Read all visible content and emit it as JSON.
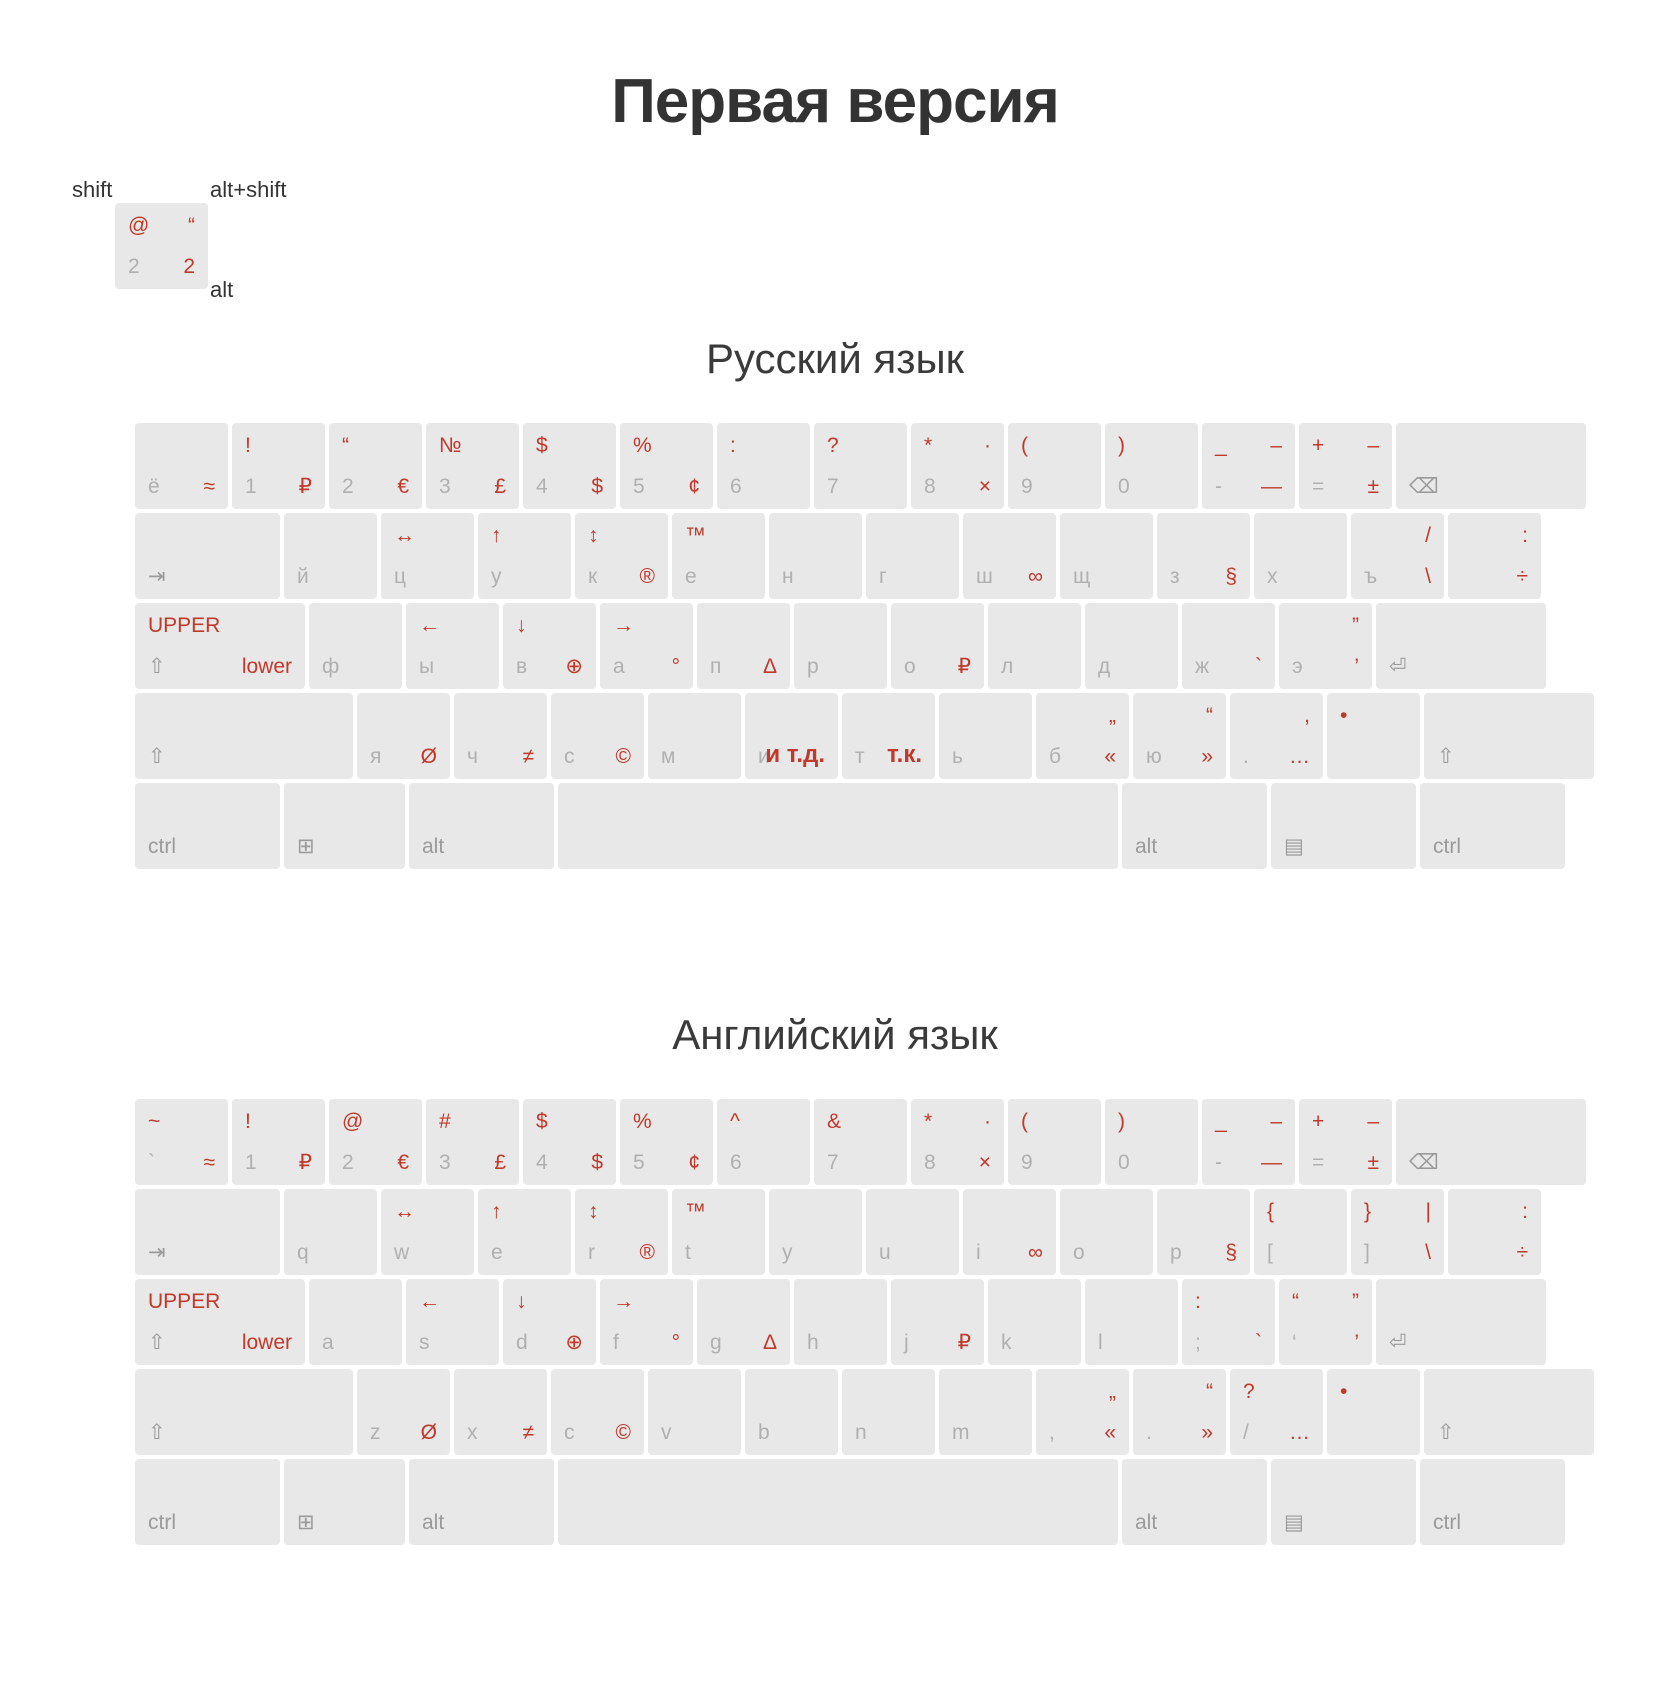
{
  "title": "Первая версия",
  "legend": {
    "shift_label": "shift",
    "altshift_label": "alt+shift",
    "alt_label": "alt",
    "key": {
      "tl": "@",
      "tr": "“",
      "bl": "2",
      "br": "2"
    }
  },
  "sections": [
    {
      "heading": "Русский язык",
      "rows": [
        {
          "name": "number-row",
          "keys": [
            {
              "tl": "",
              "tr": "",
              "bl": "ё",
              "br": "≈"
            },
            {
              "tl": "!",
              "tr": "",
              "bl": "1",
              "br": "₽"
            },
            {
              "tl": "“",
              "tr": "",
              "bl": "2",
              "br": "€"
            },
            {
              "tl": "№",
              "tr": "",
              "bl": "3",
              "br": "£"
            },
            {
              "tl": "$",
              "tr": "",
              "bl": "4",
              "br": "$"
            },
            {
              "tl": "%",
              "tr": "",
              "bl": "5",
              "br": "¢"
            },
            {
              "tl": ":",
              "tr": "",
              "bl": "6",
              "br": ""
            },
            {
              "tl": "?",
              "tr": "",
              "bl": "7",
              "br": ""
            },
            {
              "tl": "*",
              "tr": "·",
              "bl": "8",
              "br": "×"
            },
            {
              "tl": "(",
              "tr": "",
              "bl": "9",
              "br": ""
            },
            {
              "tl": ")",
              "tr": "",
              "bl": "0",
              "br": ""
            },
            {
              "tl": "_",
              "tr": "–",
              "bl": "-",
              "br": "—"
            },
            {
              "tl": "+",
              "tr": "–",
              "bl": "=",
              "br": "±"
            },
            {
              "tl": "",
              "tr": "",
              "bl": "⌫",
              "br": "",
              "width": "wbsp",
              "mod": true
            }
          ]
        },
        {
          "name": "tab-row",
          "keys": [
            {
              "tl": "",
              "tr": "",
              "bl": "⇥",
              "br": "",
              "width": "w150",
              "mod": true
            },
            {
              "tl": "",
              "tr": "",
              "bl": "й",
              "br": ""
            },
            {
              "tl": "↔",
              "tr": "",
              "bl": "ц",
              "br": ""
            },
            {
              "tl": "↑",
              "tr": "",
              "bl": "у",
              "br": ""
            },
            {
              "tl": "↕",
              "tr": "",
              "bl": "к",
              "br": "®"
            },
            {
              "tl": "™",
              "tr": "",
              "bl": "е",
              "br": ""
            },
            {
              "tl": "",
              "tr": "",
              "bl": "н",
              "br": ""
            },
            {
              "tl": "",
              "tr": "",
              "bl": "г",
              "br": ""
            },
            {
              "tl": "",
              "tr": "",
              "bl": "ш",
              "br": "∞"
            },
            {
              "tl": "",
              "tr": "",
              "bl": "щ",
              "br": ""
            },
            {
              "tl": "",
              "tr": "",
              "bl": "з",
              "br": "§"
            },
            {
              "tl": "",
              "tr": "",
              "bl": "х",
              "br": ""
            },
            {
              "tl": "",
              "tr": "/",
              "bl": "ъ",
              "br": "\\"
            },
            {
              "tl": "",
              "tr": ":",
              "bl": "",
              "br": "÷",
              "width": "w100"
            }
          ]
        },
        {
          "name": "caps-row",
          "keys": [
            {
              "tl": "UPPER",
              "tr": "",
              "bl": "⇧",
              "br": "lower",
              "width": "w175",
              "mod": true,
              "brRed": true
            },
            {
              "tl": "",
              "tr": "",
              "bl": "ф",
              "br": ""
            },
            {
              "tl": "←",
              "tr": "",
              "bl": "ы",
              "br": ""
            },
            {
              "tl": "↓",
              "tr": "",
              "bl": "в",
              "br": "⊕"
            },
            {
              "tl": "→",
              "tr": "",
              "bl": "а",
              "br": "°"
            },
            {
              "tl": "",
              "tr": "",
              "bl": "п",
              "br": "Δ"
            },
            {
              "tl": "",
              "tr": "",
              "bl": "р",
              "br": ""
            },
            {
              "tl": "",
              "tr": "",
              "bl": "о",
              "br": "₽"
            },
            {
              "tl": "",
              "tr": "",
              "bl": "л",
              "br": ""
            },
            {
              "tl": "",
              "tr": "",
              "bl": "д",
              "br": ""
            },
            {
              "tl": "",
              "tr": "",
              "bl": "ж",
              "br": "`"
            },
            {
              "tl": "",
              "tr": "”",
              "bl": "э",
              "br": "’"
            },
            {
              "tl": "",
              "tr": "",
              "bl": "⏎",
              "br": "",
              "width": "wenter",
              "mod": true
            }
          ]
        },
        {
          "name": "shift-row",
          "keys": [
            {
              "tl": "",
              "tr": "",
              "bl": "⇧",
              "br": "",
              "width": "w225",
              "mod": true
            },
            {
              "tl": "",
              "tr": "",
              "bl": "я",
              "br": "Ø"
            },
            {
              "tl": "",
              "tr": "",
              "bl": "ч",
              "br": "≠"
            },
            {
              "tl": "",
              "tr": "",
              "bl": "с",
              "br": "©"
            },
            {
              "tl": "",
              "tr": "",
              "bl": "м",
              "br": ""
            },
            {
              "tl": "",
              "tr": "",
              "bl": "и",
              "br": "и т.д.",
              "brWide": true
            },
            {
              "tl": "",
              "tr": "",
              "bl": "т",
              "br": "т.к.",
              "brWide": true
            },
            {
              "tl": "",
              "tr": "",
              "bl": "ь",
              "br": ""
            },
            {
              "tl": "",
              "tr": "„",
              "bl": "б",
              "br": "«"
            },
            {
              "tl": "",
              "tr": "“",
              "bl": "ю",
              "br": "»"
            },
            {
              "tl": "",
              "tr": ",",
              "bl": ".",
              "br": "…"
            },
            {
              "tl": "•",
              "tr": "",
              "bl": "",
              "br": "",
              "width": "w100"
            },
            {
              "tl": "",
              "tr": "",
              "bl": "⇧",
              "br": "",
              "width": "wshiftR",
              "mod": true
            }
          ]
        },
        {
          "name": "bottom-row",
          "keys": [
            {
              "tl": "",
              "tr": "",
              "bl": "ctrl",
              "br": "",
              "width": "w150",
              "mod": true
            },
            {
              "tl": "",
              "tr": "",
              "bl": "⊞",
              "br": "",
              "width": "w125",
              "mod": true
            },
            {
              "tl": "",
              "tr": "",
              "bl": "alt",
              "br": "",
              "width": "w150",
              "mod": true
            },
            {
              "tl": "",
              "tr": "",
              "bl": "",
              "br": "",
              "width": "wspace",
              "mod": true
            },
            {
              "tl": "",
              "tr": "",
              "bl": "alt",
              "br": "",
              "width": "w150",
              "mod": true
            },
            {
              "tl": "",
              "tr": "",
              "bl": "▤",
              "br": "",
              "width": "w150",
              "mod": true
            },
            {
              "tl": "",
              "tr": "",
              "bl": "ctrl",
              "br": "",
              "width": "w150",
              "mod": true
            }
          ]
        }
      ]
    },
    {
      "heading": "Английский язык",
      "rows": [
        {
          "name": "number-row",
          "keys": [
            {
              "tl": "~",
              "tr": "",
              "bl": "`",
              "br": "≈"
            },
            {
              "tl": "!",
              "tr": "",
              "bl": "1",
              "br": "₽"
            },
            {
              "tl": "@",
              "tr": "",
              "bl": "2",
              "br": "€"
            },
            {
              "tl": "#",
              "tr": "",
              "bl": "3",
              "br": "£"
            },
            {
              "tl": "$",
              "tr": "",
              "bl": "4",
              "br": "$"
            },
            {
              "tl": "%",
              "tr": "",
              "bl": "5",
              "br": "¢"
            },
            {
              "tl": "^",
              "tr": "",
              "bl": "6",
              "br": ""
            },
            {
              "tl": "&",
              "tr": "",
              "bl": "7",
              "br": ""
            },
            {
              "tl": "*",
              "tr": "·",
              "bl": "8",
              "br": "×"
            },
            {
              "tl": "(",
              "tr": "",
              "bl": "9",
              "br": ""
            },
            {
              "tl": ")",
              "tr": "",
              "bl": "0",
              "br": ""
            },
            {
              "tl": "_",
              "tr": "–",
              "bl": "-",
              "br": "—"
            },
            {
              "tl": "+",
              "tr": "–",
              "bl": "=",
              "br": "±"
            },
            {
              "tl": "",
              "tr": "",
              "bl": "⌫",
              "br": "",
              "width": "wbsp",
              "mod": true
            }
          ]
        },
        {
          "name": "tab-row",
          "keys": [
            {
              "tl": "",
              "tr": "",
              "bl": "⇥",
              "br": "",
              "width": "w150",
              "mod": true
            },
            {
              "tl": "",
              "tr": "",
              "bl": "q",
              "br": ""
            },
            {
              "tl": "↔",
              "tr": "",
              "bl": "w",
              "br": ""
            },
            {
              "tl": "↑",
              "tr": "",
              "bl": "e",
              "br": ""
            },
            {
              "tl": "↕",
              "tr": "",
              "bl": "r",
              "br": "®"
            },
            {
              "tl": "™",
              "tr": "",
              "bl": "t",
              "br": ""
            },
            {
              "tl": "",
              "tr": "",
              "bl": "y",
              "br": ""
            },
            {
              "tl": "",
              "tr": "",
              "bl": "u",
              "br": ""
            },
            {
              "tl": "",
              "tr": "",
              "bl": "i",
              "br": "∞"
            },
            {
              "tl": "",
              "tr": "",
              "bl": "o",
              "br": ""
            },
            {
              "tl": "",
              "tr": "",
              "bl": "p",
              "br": "§"
            },
            {
              "tl": "{",
              "tr": "",
              "bl": "[",
              "br": ""
            },
            {
              "tl": "}",
              "tr": "|",
              "bl": "]",
              "br": "\\"
            },
            {
              "tl": "",
              "tr": ":",
              "bl": "",
              "br": "÷",
              "width": "w100"
            }
          ]
        },
        {
          "name": "caps-row",
          "keys": [
            {
              "tl": "UPPER",
              "tr": "",
              "bl": "⇧",
              "br": "lower",
              "width": "w175",
              "mod": true,
              "brRed": true
            },
            {
              "tl": "",
              "tr": "",
              "bl": "a",
              "br": ""
            },
            {
              "tl": "←",
              "tr": "",
              "bl": "s",
              "br": ""
            },
            {
              "tl": "↓",
              "tr": "",
              "bl": "d",
              "br": "⊕"
            },
            {
              "tl": "→",
              "tr": "",
              "bl": "f",
              "br": "°"
            },
            {
              "tl": "",
              "tr": "",
              "bl": "g",
              "br": "Δ"
            },
            {
              "tl": "",
              "tr": "",
              "bl": "h",
              "br": ""
            },
            {
              "tl": "",
              "tr": "",
              "bl": "j",
              "br": "₽"
            },
            {
              "tl": "",
              "tr": "",
              "bl": "k",
              "br": ""
            },
            {
              "tl": "",
              "tr": "",
              "bl": "l",
              "br": ""
            },
            {
              "tl": ":",
              "tr": "",
              "bl": ";",
              "br": "`"
            },
            {
              "tl": "“",
              "tr": "”",
              "bl": "‘",
              "br": "’"
            },
            {
              "tl": "",
              "tr": "",
              "bl": "⏎",
              "br": "",
              "width": "wenter",
              "mod": true
            }
          ]
        },
        {
          "name": "shift-row",
          "keys": [
            {
              "tl": "",
              "tr": "",
              "bl": "⇧",
              "br": "",
              "width": "w225",
              "mod": true
            },
            {
              "tl": "",
              "tr": "",
              "bl": "z",
              "br": "Ø"
            },
            {
              "tl": "",
              "tr": "",
              "bl": "x",
              "br": "≠"
            },
            {
              "tl": "",
              "tr": "",
              "bl": "c",
              "br": "©"
            },
            {
              "tl": "",
              "tr": "",
              "bl": "v",
              "br": ""
            },
            {
              "tl": "",
              "tr": "",
              "bl": "b",
              "br": ""
            },
            {
              "tl": "",
              "tr": "",
              "bl": "n",
              "br": ""
            },
            {
              "tl": "",
              "tr": "",
              "bl": "m",
              "br": ""
            },
            {
              "tl": "",
              "tr": "„",
              "bl": ",",
              "br": "«"
            },
            {
              "tl": "",
              "tr": "“",
              "bl": ".",
              "br": "»"
            },
            {
              "tl": "?",
              "tr": "",
              "bl": "/",
              "br": "…"
            },
            {
              "tl": "•",
              "tr": "",
              "bl": "",
              "br": "",
              "width": "w100"
            },
            {
              "tl": "",
              "tr": "",
              "bl": "⇧",
              "br": "",
              "width": "wshiftR",
              "mod": true
            }
          ]
        },
        {
          "name": "bottom-row",
          "keys": [
            {
              "tl": "",
              "tr": "",
              "bl": "ctrl",
              "br": "",
              "width": "w150",
              "mod": true
            },
            {
              "tl": "",
              "tr": "",
              "bl": "⊞",
              "br": "",
              "width": "w125",
              "mod": true
            },
            {
              "tl": "",
              "tr": "",
              "bl": "alt",
              "br": "",
              "width": "w150",
              "mod": true
            },
            {
              "tl": "",
              "tr": "",
              "bl": "",
              "br": "",
              "width": "wspace",
              "mod": true
            },
            {
              "tl": "",
              "tr": "",
              "bl": "alt",
              "br": "",
              "width": "w150",
              "mod": true
            },
            {
              "tl": "",
              "tr": "",
              "bl": "▤",
              "br": "",
              "width": "w150",
              "mod": true
            },
            {
              "tl": "",
              "tr": "",
              "bl": "ctrl",
              "br": "",
              "width": "w150",
              "mod": true
            }
          ]
        }
      ]
    }
  ],
  "colors": {
    "accent": "#c0392b",
    "key_bg": "#e8e8e8",
    "base_label": "#b0b0b0"
  }
}
